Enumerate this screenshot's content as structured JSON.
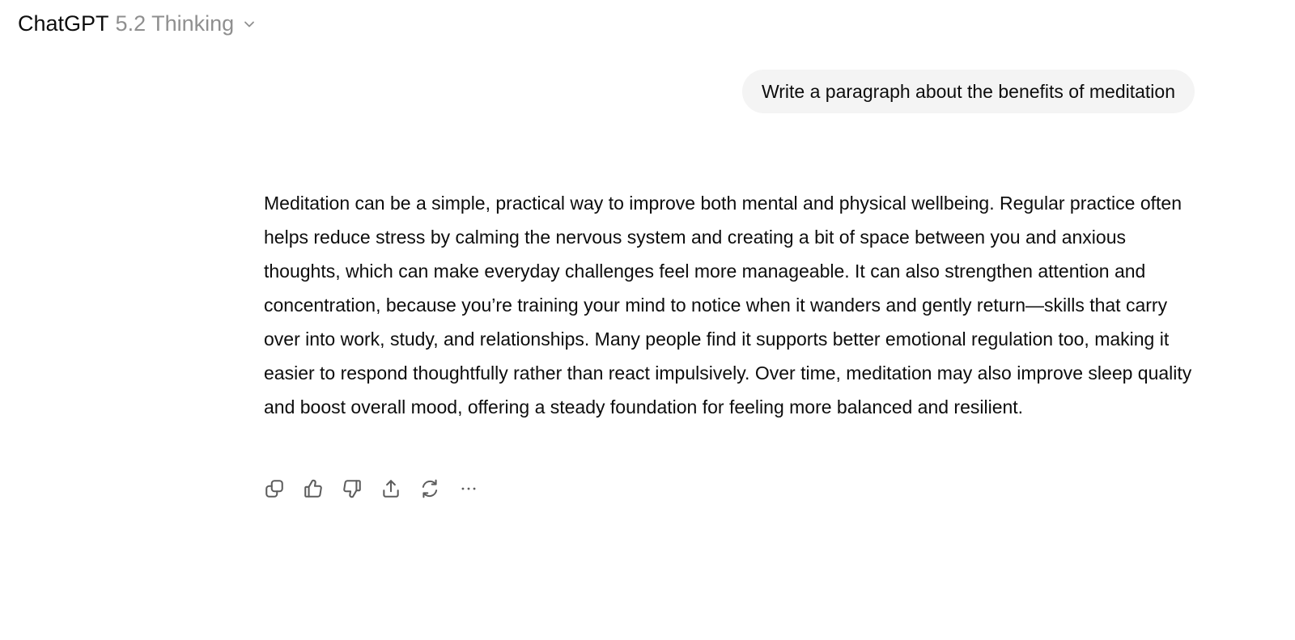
{
  "header": {
    "app_name": "ChatGPT",
    "model_variant": "5.2 Thinking",
    "dropdown_icon": "chevron-down-icon"
  },
  "conversation": {
    "user_message": "Write a paragraph about the benefits of meditation",
    "assistant_message": "Meditation can be a simple, practical way to improve both mental and physical wellbeing. Regular practice often helps reduce stress by calming the nervous system and creating a bit of space between you and anxious thoughts, which can make everyday challenges feel more manageable. It can also strengthen attention and concentration, because you’re training your mind to notice when it wanders and gently return—skills that carry over into work, study, and relationships. Many people find it supports better emotional regulation too, making it easier to respond thoughtfully rather than react impulsively. Over time, meditation may also improve sleep quality and boost overall mood, offering a steady foundation for feeling more balanced and resilient."
  },
  "actions": [
    {
      "icon": "copy-icon"
    },
    {
      "icon": "thumbs-up-icon"
    },
    {
      "icon": "thumbs-down-icon"
    },
    {
      "icon": "share-icon"
    },
    {
      "icon": "regenerate-icon"
    },
    {
      "icon": "more-icon"
    }
  ],
  "colors": {
    "background": "#ffffff",
    "text": "#0d0d0d",
    "muted_text": "#8f8f8f",
    "user_bubble": "#f4f4f4",
    "icon": "#5d5d5d"
  }
}
